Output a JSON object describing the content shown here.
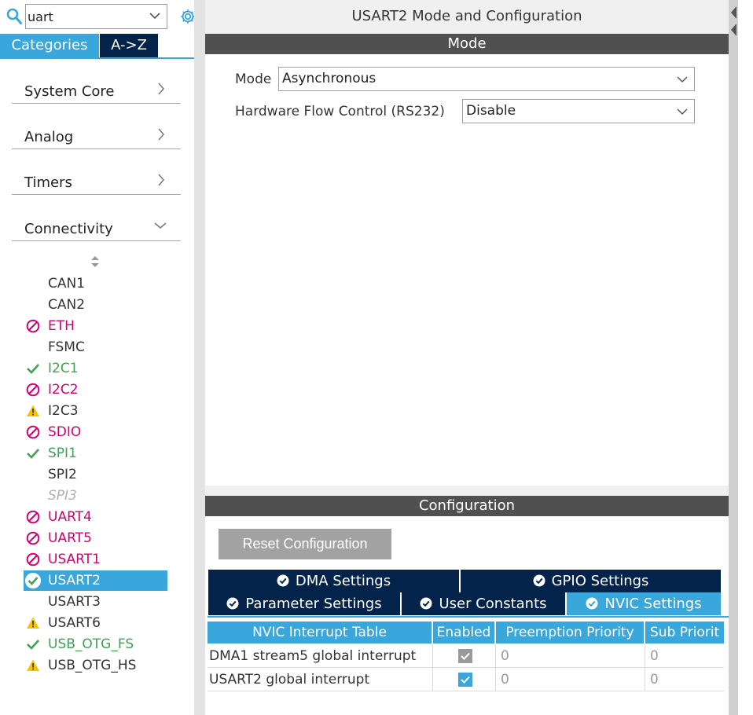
{
  "search": {
    "value": "uart"
  },
  "categories_tabs": {
    "categories": "Categories",
    "az": "A->Z"
  },
  "categories": [
    {
      "label": "System Core",
      "state": "collapsed"
    },
    {
      "label": "Analog",
      "state": "collapsed"
    },
    {
      "label": "Timers",
      "state": "collapsed"
    },
    {
      "label": "Connectivity",
      "state": "expanded"
    }
  ],
  "peripherals": [
    {
      "label": "CAN1",
      "status": "none",
      "color": "#333333"
    },
    {
      "label": "CAN2",
      "status": "none",
      "color": "#333333"
    },
    {
      "label": "ETH",
      "status": "blocked",
      "color": "#d4006f"
    },
    {
      "label": "FSMC",
      "status": "none",
      "color": "#333333"
    },
    {
      "label": "I2C1",
      "status": "ok",
      "color": "#3fa352"
    },
    {
      "label": "I2C2",
      "status": "blocked",
      "color": "#d4006f"
    },
    {
      "label": "I2C3",
      "status": "warning",
      "color": "#333333"
    },
    {
      "label": "SDIO",
      "status": "blocked",
      "color": "#d4006f"
    },
    {
      "label": "SPI1",
      "status": "ok",
      "color": "#3fa352"
    },
    {
      "label": "SPI2",
      "status": "none",
      "color": "#333333"
    },
    {
      "label": "SPI3",
      "status": "disabled",
      "color": "#b0b0b0"
    },
    {
      "label": "UART4",
      "status": "blocked",
      "color": "#d4006f"
    },
    {
      "label": "UART5",
      "status": "blocked",
      "color": "#d4006f"
    },
    {
      "label": "USART1",
      "status": "blocked",
      "color": "#d4006f"
    },
    {
      "label": "USART2",
      "status": "selected",
      "color": "#ffffff"
    },
    {
      "label": "USART3",
      "status": "none",
      "color": "#333333"
    },
    {
      "label": "USART6",
      "status": "warning",
      "color": "#333333"
    },
    {
      "label": "USB_OTG_FS",
      "status": "ok",
      "color": "#3fa352"
    },
    {
      "label": "USB_OTG_HS",
      "status": "warning",
      "color": "#333333"
    }
  ],
  "panel": {
    "title": "USART2 Mode and Configuration",
    "mode_section": "Mode",
    "config_section": "Configuration"
  },
  "mode": {
    "mode_label": "Mode",
    "mode_value": "Asynchronous",
    "hfc_label": "Hardware Flow Control (RS232)",
    "hfc_value": "Disable"
  },
  "config": {
    "reset_label": "Reset Configuration",
    "tabs_row1": [
      "DMA Settings",
      "GPIO Settings"
    ],
    "tabs_row2": [
      "Parameter Settings",
      "User Constants",
      "NVIC Settings"
    ],
    "active_tab": "NVIC Settings"
  },
  "nvic": {
    "headers": [
      "NVIC Interrupt Table",
      "Enabled",
      "Preemption Priority",
      "Sub Priorit"
    ],
    "rows": [
      {
        "name": "DMA1 stream5 global interrupt",
        "enabled": true,
        "locked": true,
        "preemption": "0",
        "sub": "0"
      },
      {
        "name": "USART2 global interrupt",
        "enabled": true,
        "locked": false,
        "preemption": "0",
        "sub": "0"
      }
    ]
  },
  "colors": {
    "accent": "#3aa7dc",
    "navy": "#03234b",
    "section_bar": "#505050",
    "error": "#d4006f",
    "ok": "#3fa352",
    "warning": "#f5c400"
  }
}
